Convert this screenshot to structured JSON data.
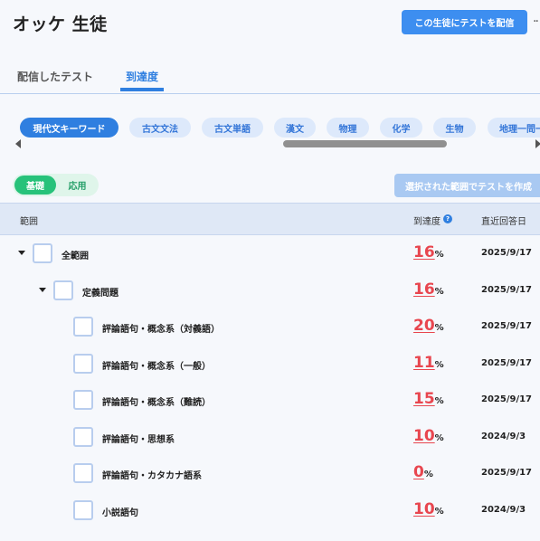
{
  "header": {
    "student_name": "オッケ 生徒",
    "deliver_button": "この生徒にテストを配信",
    "more_icon": "ellipsis-icon"
  },
  "tabs": [
    {
      "label": "配信したテスト",
      "active": false
    },
    {
      "label": "到達度",
      "active": true
    }
  ],
  "subjects": [
    {
      "label": "現代文キーワード",
      "active": true
    },
    {
      "label": "古文文法",
      "active": false
    },
    {
      "label": "古文単語",
      "active": false
    },
    {
      "label": "漢文",
      "active": false
    },
    {
      "label": "物理",
      "active": false
    },
    {
      "label": "化学",
      "active": false
    },
    {
      "label": "生物",
      "active": false
    },
    {
      "label": "地理一問一",
      "active": false
    }
  ],
  "level_toggle": {
    "options": [
      "基礎",
      "応用"
    ],
    "selected": "基礎"
  },
  "create_button": "選択された範囲でテストを作成",
  "table": {
    "columns": {
      "range": "範囲",
      "achievement": "到達度",
      "last_answer": "直近回答日"
    },
    "help_icon": "question-circle-icon",
    "unit": "%",
    "rows": [
      {
        "label": "全範囲",
        "level": 0,
        "expandable": true,
        "pct": "16",
        "date": "2025/9/17"
      },
      {
        "label": "定義問題",
        "level": 1,
        "expandable": true,
        "pct": "16",
        "date": "2025/9/17"
      },
      {
        "label": "評論語句・概念系（対義語）",
        "level": 2,
        "expandable": false,
        "pct": "20",
        "date": "2025/9/17"
      },
      {
        "label": "評論語句・概念系（一般）",
        "level": 2,
        "expandable": false,
        "pct": "11",
        "date": "2025/9/17"
      },
      {
        "label": "評論語句・概念系（難読）",
        "level": 2,
        "expandable": false,
        "pct": "15",
        "date": "2025/9/17"
      },
      {
        "label": "評論語句・思想系",
        "level": 2,
        "expandable": false,
        "pct": "10",
        "date": "2024/9/3"
      },
      {
        "label": "評論語句・カタカナ語系",
        "level": 2,
        "expandable": false,
        "pct": "0",
        "date": "2025/9/17"
      },
      {
        "label": "小説語句",
        "level": 2,
        "expandable": false,
        "pct": "10",
        "date": "2024/9/3"
      }
    ]
  },
  "colors": {
    "primary": "#2f7fe0",
    "accent_green": "#27c27a",
    "percent_red": "#e8464f"
  }
}
